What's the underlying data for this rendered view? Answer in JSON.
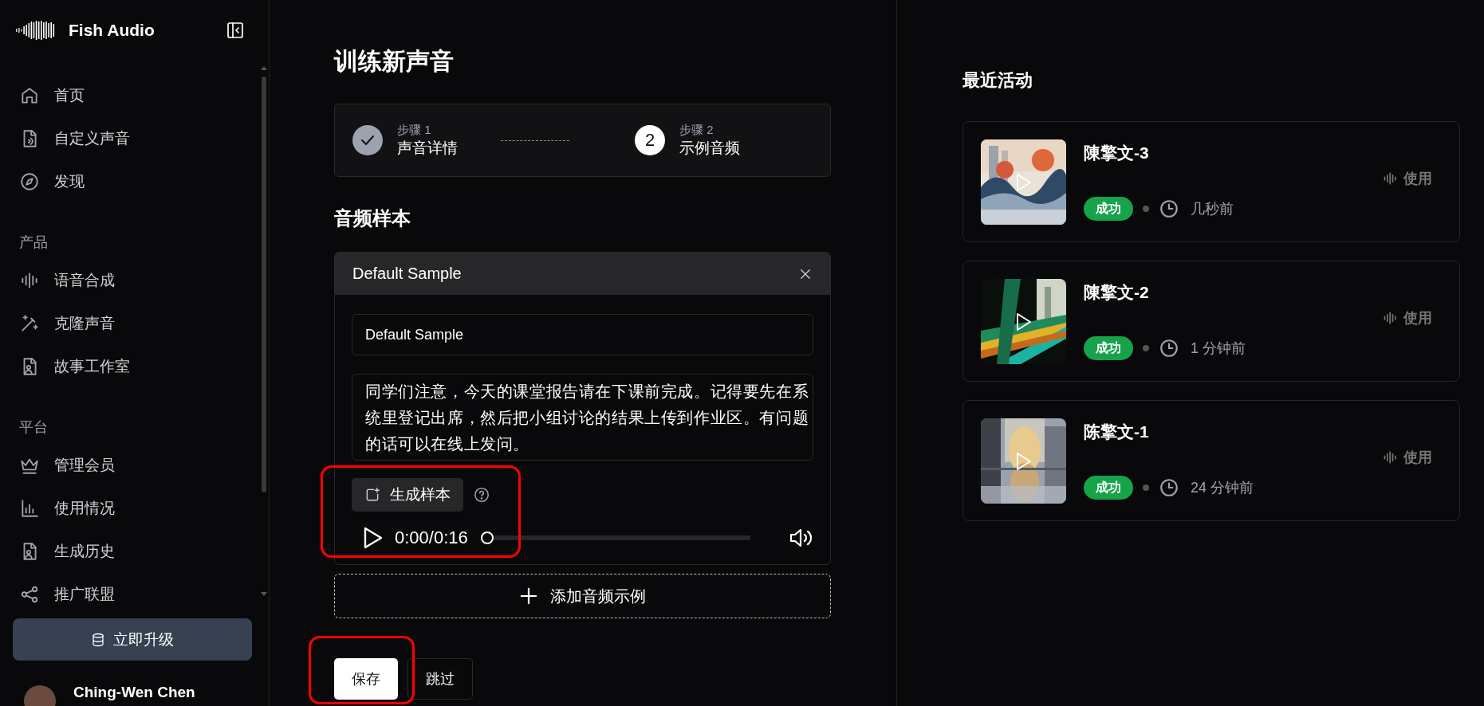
{
  "app": {
    "name": "Fish Audio"
  },
  "sidebar": {
    "sections": [
      {
        "items": [
          {
            "label": "首页",
            "kind": "home"
          },
          {
            "label": "自定义声音",
            "kind": "audio-file"
          },
          {
            "label": "发现",
            "kind": "compass"
          }
        ]
      },
      {
        "title": "产品",
        "items": [
          {
            "label": "语音合成",
            "kind": "waveform"
          },
          {
            "label": "克隆声音",
            "kind": "wand"
          },
          {
            "label": "故事工作室",
            "kind": "person-file"
          }
        ]
      },
      {
        "title": "平台",
        "items": [
          {
            "label": "管理会员",
            "kind": "crown"
          },
          {
            "label": "使用情况",
            "kind": "chart"
          },
          {
            "label": "生成历史",
            "kind": "person-file"
          },
          {
            "label": "推广联盟",
            "kind": "share"
          }
        ]
      }
    ],
    "upgrade_button": "立即升级",
    "user": {
      "name": "Ching-Wen Chen"
    }
  },
  "page": {
    "title": "训练新声音",
    "steps": [
      {
        "caption": "步骤 1",
        "title": "声音详情",
        "done": true,
        "selected": false
      },
      {
        "number": "2",
        "caption": "步骤 2",
        "title": "示例音频",
        "done": false,
        "selected": true
      }
    ],
    "samples_heading": "音频样本",
    "samples": [
      {
        "title": "Default Sample",
        "name_value": "Default Sample",
        "text_value": "同学们注意，今天的课堂报告请在下课前完成。记得要先在系统里登记出席，然后把小组讨论的结果上传到作业区。有问题的话可以在线上发问。",
        "generate_button": "生成样本",
        "player": {
          "time": "0:00/0:16",
          "level": 0
        }
      }
    ],
    "add_button": "添加音频示例",
    "actions": [
      {
        "label": "保存",
        "kind": "primary"
      },
      {
        "label": "跳过",
        "kind": "secondary"
      }
    ]
  },
  "recent": {
    "title": "最近活动",
    "items": [
      {
        "name": "陳擎文-3",
        "status": "成功",
        "time": "几秒前",
        "use_label": "使用"
      },
      {
        "name": "陳擎文-2",
        "status": "成功",
        "time": "1 分钟前",
        "use_label": "使用"
      },
      {
        "name": "陈擎文-1",
        "status": "成功",
        "time": "24 分钟前",
        "use_label": "使用"
      }
    ]
  }
}
